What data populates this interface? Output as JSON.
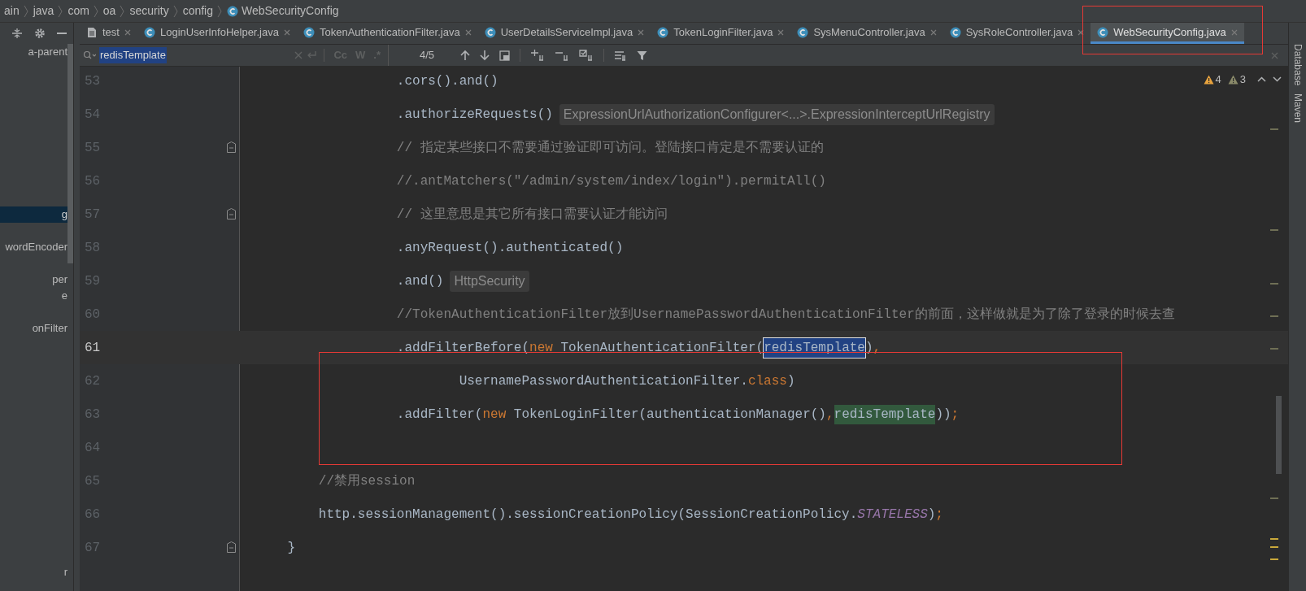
{
  "breadcrumbs": [
    {
      "label": "ain",
      "kind": "folder"
    },
    {
      "label": "java",
      "kind": "folder"
    },
    {
      "label": "com",
      "kind": "folder"
    },
    {
      "label": "oa",
      "kind": "folder"
    },
    {
      "label": "security",
      "kind": "folder"
    },
    {
      "label": "config",
      "kind": "folder"
    },
    {
      "label": "WebSecurityConfig",
      "kind": "class"
    }
  ],
  "project_panel": {
    "items": [
      {
        "label": "a-parent",
        "selected": false
      },
      {
        "label": "g",
        "selected": true
      },
      {
        "label": "wordEncoder",
        "selected": false
      },
      {
        "label": "per",
        "selected": false
      },
      {
        "label": "e",
        "selected": false
      },
      {
        "label": "onFilter",
        "selected": false
      },
      {
        "label": "r",
        "selected": false
      }
    ]
  },
  "tabs": [
    {
      "label": "test",
      "kind": "file",
      "selected": false
    },
    {
      "label": "LoginUserInfoHelper.java",
      "kind": "class",
      "selected": false
    },
    {
      "label": "TokenAuthenticationFilter.java",
      "kind": "class",
      "selected": false
    },
    {
      "label": "UserDetailsServiceImpl.java",
      "kind": "class",
      "selected": false
    },
    {
      "label": "TokenLoginFilter.java",
      "kind": "class",
      "selected": false
    },
    {
      "label": "SysMenuController.java",
      "kind": "class",
      "selected": false
    },
    {
      "label": "SysRoleController.java",
      "kind": "class",
      "selected": false
    },
    {
      "label": "WebSecurityConfig.java",
      "kind": "class",
      "selected": true
    }
  ],
  "search": {
    "value": "redisTemplate",
    "case_toggle": "Cc",
    "word_toggle": "W",
    "regex_toggle": ".*",
    "match_count": "4/5"
  },
  "inspections": {
    "warnings": "4",
    "weak_warnings": "3"
  },
  "lines": [
    {
      "number": "53",
      "current": false,
      "foldable": false,
      "tokens": [
        {
          "kind": "plain",
          "text": "                  .cors().and()"
        }
      ]
    },
    {
      "number": "54",
      "current": false,
      "foldable": false,
      "tokens": [
        {
          "kind": "plain",
          "text": "                  .authorizeRequests()"
        },
        {
          "kind": "hint",
          "text": "ExpressionUrlAuthorizationConfigurer<...>.ExpressionInterceptUrlRegistry"
        }
      ]
    },
    {
      "number": "55",
      "current": false,
      "foldable": true,
      "tokens": [
        {
          "kind": "comment",
          "text": "                  // 指定某些接口不需要通过验证即可访问。登陆接口肯定是不需要认证的"
        }
      ]
    },
    {
      "number": "56",
      "current": false,
      "foldable": false,
      "tokens": [
        {
          "kind": "comment",
          "text": "                  //.antMatchers(\"/admin/system/index/login\").permitAll()"
        }
      ]
    },
    {
      "number": "57",
      "current": false,
      "foldable": true,
      "tokens": [
        {
          "kind": "comment",
          "text": "                  // 这里意思是其它所有接口需要认证才能访问"
        }
      ]
    },
    {
      "number": "58",
      "current": false,
      "foldable": false,
      "tokens": [
        {
          "kind": "plain",
          "text": "                  .anyRequest().authenticated()"
        }
      ]
    },
    {
      "number": "59",
      "current": false,
      "foldable": false,
      "tokens": [
        {
          "kind": "plain",
          "text": "                  .and()"
        },
        {
          "kind": "hint",
          "text": "HttpSecurity"
        }
      ]
    },
    {
      "number": "60",
      "current": false,
      "foldable": false,
      "tokens": [
        {
          "kind": "comment",
          "text": "                  //TokenAuthenticationFilter放到UsernamePasswordAuthenticationFilter的前面，这样做就是为了除了登录的时候去查"
        }
      ]
    },
    {
      "number": "61",
      "current": true,
      "foldable": false,
      "tokens": [
        {
          "kind": "plain",
          "text": "                  .addFilterBefore("
        },
        {
          "kind": "keyword",
          "text": "new"
        },
        {
          "kind": "plain",
          "text": " TokenAuthenticationFilter("
        },
        {
          "kind": "search_current",
          "text": "redisTemplate"
        },
        {
          "kind": "plain",
          "text": ")"
        },
        {
          "kind": "punct",
          "text": ","
        }
      ]
    },
    {
      "number": "62",
      "current": false,
      "foldable": false,
      "tokens": [
        {
          "kind": "plain",
          "text": "                          UsernamePasswordAuthenticationFilter."
        },
        {
          "kind": "keyword",
          "text": "class"
        },
        {
          "kind": "plain",
          "text": ")"
        }
      ]
    },
    {
      "number": "63",
      "current": false,
      "foldable": false,
      "tokens": [
        {
          "kind": "plain",
          "text": "                  .addFilter("
        },
        {
          "kind": "keyword",
          "text": "new"
        },
        {
          "kind": "plain",
          "text": " TokenLoginFilter(authenticationManager()"
        },
        {
          "kind": "punct",
          "text": ","
        },
        {
          "kind": "search_match",
          "text": "redisTemplate"
        },
        {
          "kind": "plain",
          "text": "))"
        },
        {
          "kind": "punct",
          "text": ";"
        }
      ]
    },
    {
      "number": "64",
      "current": false,
      "foldable": false
    },
    {
      "number": "65",
      "current": false,
      "foldable": false,
      "tokens": [
        {
          "kind": "comment",
          "text": "        //禁用session"
        }
      ]
    },
    {
      "number": "66",
      "current": false,
      "foldable": false,
      "tokens": [
        {
          "kind": "plain",
          "text": "        http.sessionManagement().sessionCreationPolicy(SessionCreationPolicy."
        },
        {
          "kind": "constant",
          "text": "STATELESS"
        },
        {
          "kind": "plain",
          "text": ")"
        },
        {
          "kind": "punct",
          "text": ";"
        }
      ]
    },
    {
      "number": "67",
      "current": false,
      "foldable": true,
      "tokens": [
        {
          "kind": "plain",
          "text": "    }"
        }
      ]
    }
  ],
  "tool_windows": [
    {
      "label": "Database"
    },
    {
      "label": "Maven"
    }
  ]
}
